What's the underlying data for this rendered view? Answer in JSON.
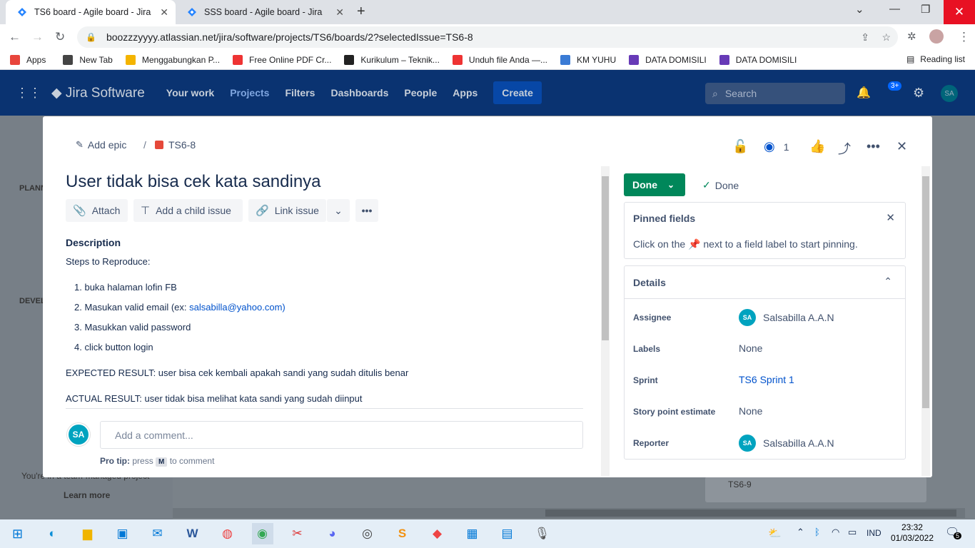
{
  "browser": {
    "tabs": [
      {
        "title": "TS6 board - Agile board - Jira",
        "active": true
      },
      {
        "title": "SSS board - Agile board - Jira",
        "active": false
      }
    ],
    "url": "boozzzyyyy.atlassian.net/jira/software/projects/TS6/boards/2?selectedIssue=TS6-8",
    "bookmarks": [
      {
        "label": "Apps",
        "icon": "apps-grid-icon",
        "color": "#e8453c"
      },
      {
        "label": "New Tab",
        "icon": "globe-icon",
        "color": "#444"
      },
      {
        "label": "Menggabungkan P...",
        "icon": "ilovepdf-icon",
        "color": "#f4b400"
      },
      {
        "label": "Free Online PDF Cr...",
        "icon": "smallpdf-icon",
        "color": "#e33"
      },
      {
        "label": "Kurikulum – Teknik...",
        "icon": "kurikulum-icon",
        "color": "#222"
      },
      {
        "label": "Unduh file Anda —...",
        "icon": "download-icon",
        "color": "#e33"
      },
      {
        "label": "KM YUHU",
        "icon": "laptop-icon",
        "color": "#3a7bd5"
      },
      {
        "label": "DATA DOMISILI",
        "icon": "forms-icon",
        "color": "#673ab7"
      },
      {
        "label": "DATA DOMISILI",
        "icon": "forms-icon",
        "color": "#673ab7"
      }
    ],
    "reading_list": "Reading list"
  },
  "jira_nav": {
    "logo": "Jira Software",
    "items": [
      "Your work",
      "Projects",
      "Filters",
      "Dashboards",
      "People",
      "Apps"
    ],
    "create": "Create",
    "search_placeholder": "Search",
    "notification_badge": "3+",
    "user_initials": "SA"
  },
  "sidebar_bg": {
    "section1": "PLANN",
    "section2": "DEVEL",
    "footer1": "You're in a team-managed project",
    "footer2": "Learn more"
  },
  "board_bg": {
    "card": "TS6-9"
  },
  "issue": {
    "add_epic": "Add epic",
    "key": "TS6-8",
    "watchers": "1",
    "title": "User tidak bisa cek kata sandinya",
    "actions": {
      "attach": "Attach",
      "add_child": "Add a child issue",
      "link": "Link issue"
    },
    "description_label": "Description",
    "steps_intro": "Steps to Reproduce:",
    "steps": [
      {
        "num": "1.",
        "text": "buka halaman lofin FB"
      },
      {
        "num": "2.",
        "text": "Masukan valid email (ex: ",
        "link": "salsabilla@yahoo.com",
        "after": ")"
      },
      {
        "num": "3.",
        "text": "Masukkan valid password"
      },
      {
        "num": "4.",
        "text": "click button login"
      }
    ],
    "expected": "EXPECTED RESULT: user bisa cek kembali apakah sandi yang sudah ditulis benar",
    "actual": "ACTUAL RESULT: user tidak bisa melihat kata sandi yang sudah diinput",
    "comment_placeholder": "Add a comment...",
    "protip_bold": "Pro tip:",
    "protip_press": "press",
    "protip_key": "M",
    "protip_after": "to comment",
    "avatar": "SA"
  },
  "right_panel": {
    "status": "Done",
    "resolution": "Done",
    "pinned_title": "Pinned fields",
    "pinned_text_a": "Click on the",
    "pinned_text_b": "next to a field label to start pinning.",
    "details_title": "Details",
    "fields": {
      "assignee_label": "Assignee",
      "assignee": "Salsabilla A.A.N",
      "assignee_initials": "SA",
      "labels_label": "Labels",
      "labels": "None",
      "sprint_label": "Sprint",
      "sprint": "TS6 Sprint 1",
      "story_label": "Story point estimate",
      "story": "None",
      "reporter_label": "Reporter",
      "reporter": "Salsabilla A.A.N",
      "reporter_initials": "SA"
    }
  },
  "taskbar": {
    "time": "23:32",
    "date": "01/03/2022",
    "lang": "IND",
    "notifications": "5"
  }
}
